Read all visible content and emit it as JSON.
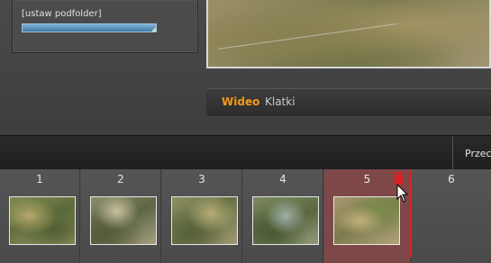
{
  "folder": {
    "label": "[ustaw podfolder]",
    "progress": 1.0
  },
  "mode_tabs": {
    "video": "Wideo",
    "frames": "Klatki"
  },
  "toolbar": {
    "partial_button": "Przec"
  },
  "filmstrip": {
    "frames": [
      {
        "number": "1",
        "has_thumb": true,
        "selected": false
      },
      {
        "number": "2",
        "has_thumb": true,
        "selected": false
      },
      {
        "number": "3",
        "has_thumb": true,
        "selected": false
      },
      {
        "number": "4",
        "has_thumb": true,
        "selected": false
      },
      {
        "number": "5",
        "has_thumb": true,
        "selected": true
      },
      {
        "number": "6",
        "has_thumb": false,
        "selected": false
      }
    ]
  },
  "colors": {
    "accent": "#f39a1e",
    "playhead": "#e02020",
    "progress": "#3f7aa5"
  },
  "icons": [
    "delete-icon",
    "mouse-cursor-icon"
  ]
}
